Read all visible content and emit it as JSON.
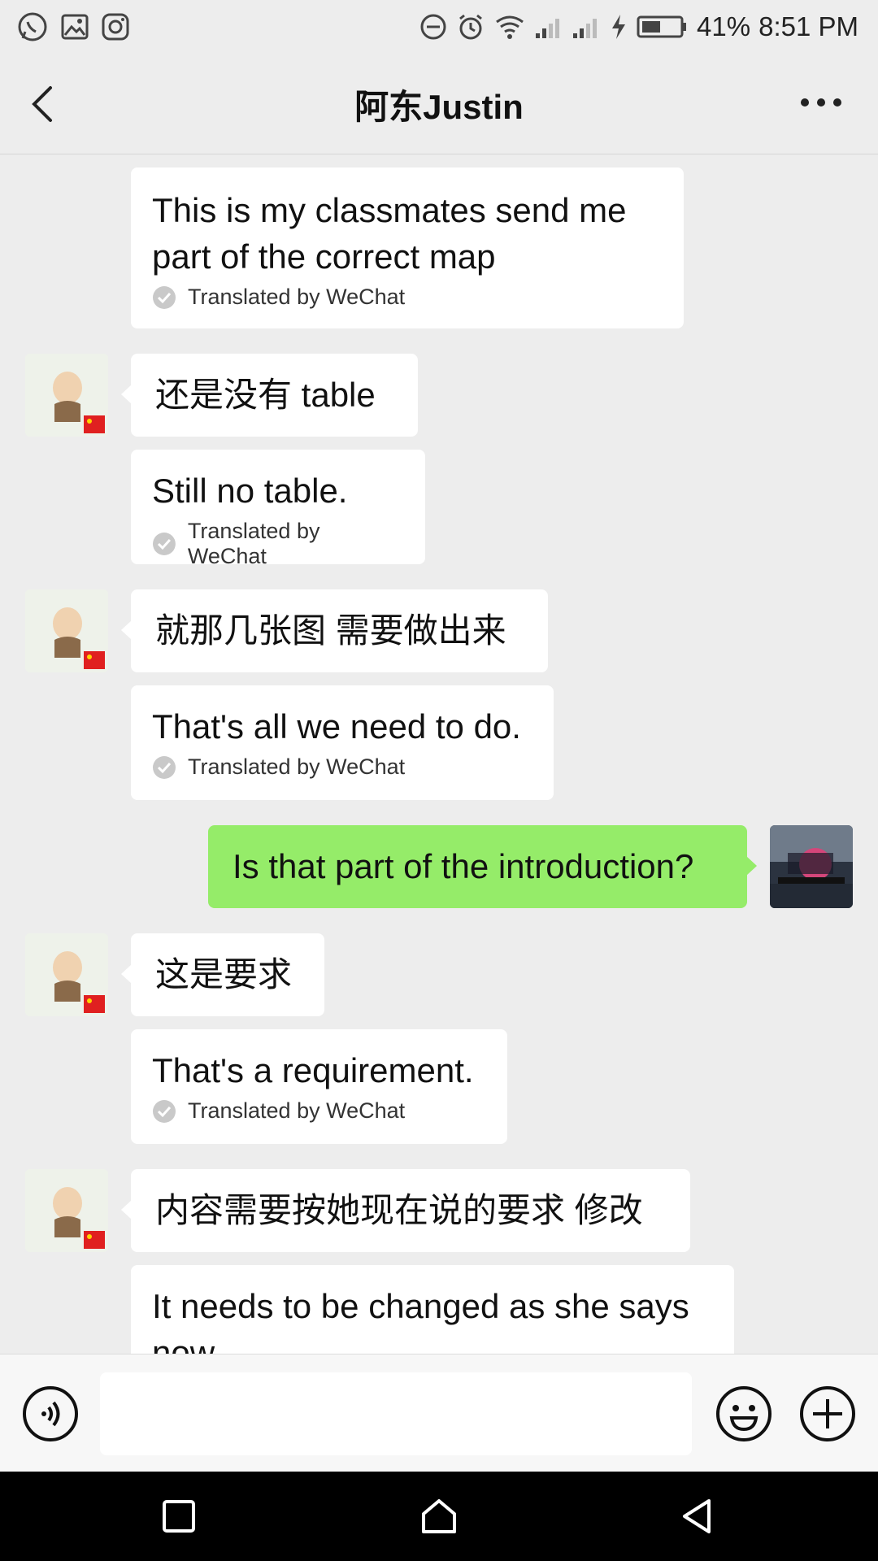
{
  "status_bar": {
    "left_icons": [
      "whatsapp-icon",
      "gallery-icon",
      "instagram-icon"
    ],
    "right_icons": [
      "dnd-icon",
      "alarm-icon",
      "wifi-icon",
      "signal-icon",
      "signal-icon",
      "charging-icon",
      "battery-icon"
    ],
    "battery_percent": "41%",
    "time": "8:51 PM"
  },
  "header": {
    "title": "阿东Justin",
    "back_icon": "chevron-left-icon",
    "more_icon": "more-dots-icon"
  },
  "messages": [
    {
      "side": "left",
      "text": "This is my classmates send me part of the correct map",
      "translation_note": "Translated by WeChat"
    },
    {
      "side": "left",
      "text": "还是没有 table"
    },
    {
      "side": "left",
      "text": "Still no table.",
      "translation_note": "Translated by WeChat"
    },
    {
      "side": "left",
      "text": "就那几张图 需要做出来"
    },
    {
      "side": "left",
      "text": "That's all we need to do.",
      "translation_note": "Translated by WeChat"
    },
    {
      "side": "right",
      "text": "Is that part of the introduction?"
    },
    {
      "side": "left",
      "text": "这是要求"
    },
    {
      "side": "left",
      "text": "That's a requirement.",
      "translation_note": "Translated by WeChat"
    },
    {
      "side": "left",
      "text": "内容需要按她现在说的要求 修改"
    },
    {
      "side": "left",
      "text": "It needs to be changed as she says now."
    }
  ],
  "input_bar": {
    "placeholder": "",
    "value": "",
    "voice_icon": "voice-icon",
    "emoji_icon": "emoji-icon",
    "plus_icon": "plus-circle-icon"
  },
  "nav_bar": {
    "icons": [
      "recents-square-icon",
      "home-icon",
      "back-triangle-icon"
    ]
  },
  "colors": {
    "chat_background": "#ededed",
    "sent_bubble": "#95ec69",
    "received_bubble": "#ffffff",
    "nav_bar": "#000000"
  }
}
